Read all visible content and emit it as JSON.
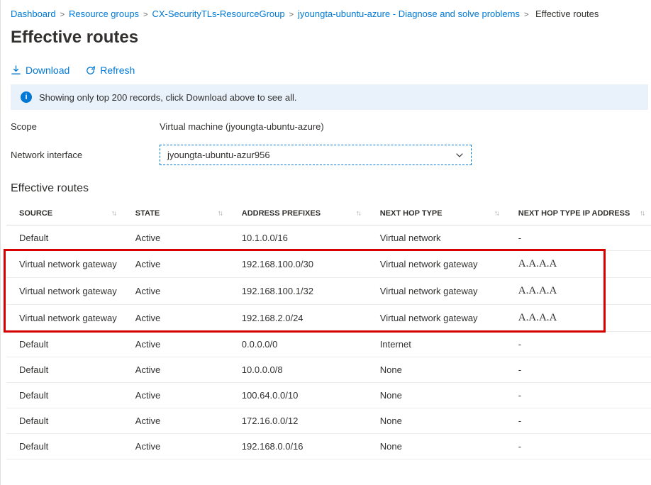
{
  "breadcrumb": {
    "items": [
      {
        "label": "Dashboard"
      },
      {
        "label": "Resource groups"
      },
      {
        "label": "CX-SecurityTLs-ResourceGroup"
      },
      {
        "label": "jyoungta-ubuntu-azure - Diagnose and solve problems"
      }
    ],
    "current": "Effective routes",
    "sep": ">"
  },
  "page_title": "Effective routes",
  "toolbar": {
    "download_label": "Download",
    "refresh_label": "Refresh"
  },
  "info_message": "Showing only top 200 records, click Download above to see all.",
  "form": {
    "scope_label": "Scope",
    "scope_value": "Virtual machine (jyoungta-ubuntu-azure)",
    "nic_label": "Network interface",
    "nic_value": "jyoungta-ubuntu-azur956"
  },
  "section_heading": "Effective routes",
  "table": {
    "columns": {
      "source": "Source",
      "state": "State",
      "address_prefixes": "Address Prefixes",
      "next_hop_type": "Next Hop Type",
      "next_hop_ip": "Next Hop Type IP Address"
    },
    "rows": [
      {
        "source": "Default",
        "state": "Active",
        "prefix": "10.1.0.0/16",
        "hop_type": "Virtual network",
        "hop_ip": "-",
        "highlighted": false
      },
      {
        "source": "Virtual network gateway",
        "state": "Active",
        "prefix": "192.168.100.0/30",
        "hop_type": "Virtual network gateway",
        "hop_ip": "A.A.A.A",
        "highlighted": true
      },
      {
        "source": "Virtual network gateway",
        "state": "Active",
        "prefix": "192.168.100.1/32",
        "hop_type": "Virtual network gateway",
        "hop_ip": "A.A.A.A",
        "highlighted": true
      },
      {
        "source": "Virtual network gateway",
        "state": "Active",
        "prefix": "192.168.2.0/24",
        "hop_type": "Virtual network gateway",
        "hop_ip": "A.A.A.A",
        "highlighted": true
      },
      {
        "source": "Default",
        "state": "Active",
        "prefix": "0.0.0.0/0",
        "hop_type": "Internet",
        "hop_ip": "-",
        "highlighted": false
      },
      {
        "source": "Default",
        "state": "Active",
        "prefix": "10.0.0.0/8",
        "hop_type": "None",
        "hop_ip": "-",
        "highlighted": false
      },
      {
        "source": "Default",
        "state": "Active",
        "prefix": "100.64.0.0/10",
        "hop_type": "None",
        "hop_ip": "-",
        "highlighted": false
      },
      {
        "source": "Default",
        "state": "Active",
        "prefix": "172.16.0.0/12",
        "hop_type": "None",
        "hop_ip": "-",
        "highlighted": false
      },
      {
        "source": "Default",
        "state": "Active",
        "prefix": "192.168.0.0/16",
        "hop_type": "None",
        "hop_ip": "-",
        "highlighted": false
      }
    ]
  }
}
